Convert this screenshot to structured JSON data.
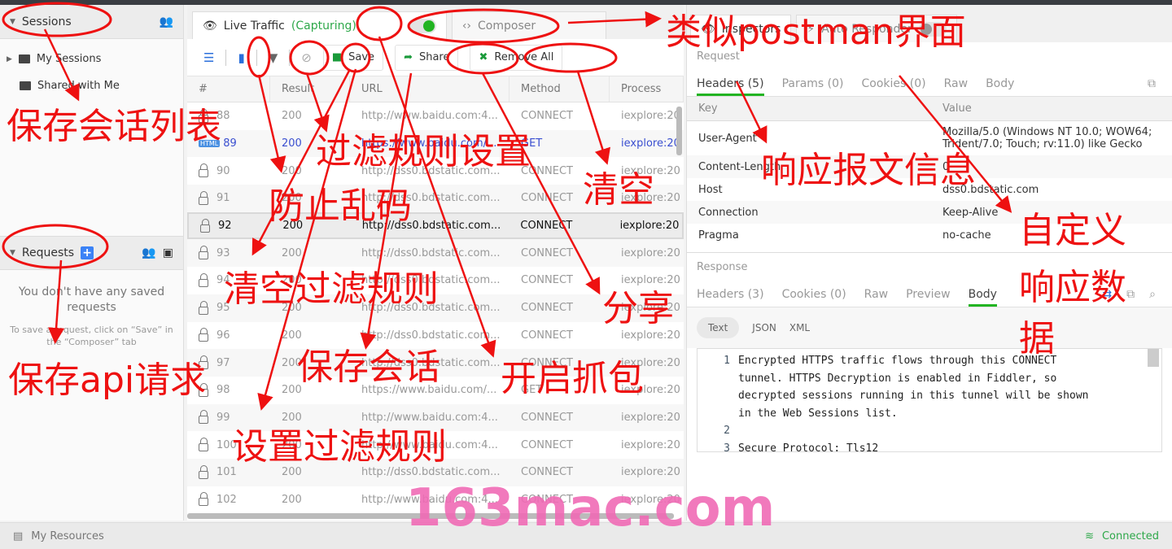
{
  "sidebar": {
    "sessions_title": "Sessions",
    "items": [
      {
        "label": "My Sessions"
      },
      {
        "label": "Shared with Me"
      }
    ],
    "requests_title": "Requests",
    "empty_title": "You don't have any saved requests",
    "empty_hint": "To save a request, click on “Save” in the “Composer” tab"
  },
  "main": {
    "tabs": [
      {
        "label": "Live Traffic",
        "status": "(Capturing)",
        "capturing": true
      },
      {
        "label": "Composer"
      }
    ],
    "toolbar": {
      "save": "Save",
      "share": "Share",
      "remove_all": "Remove All"
    },
    "columns": [
      "#",
      "Result",
      "URL",
      "Method",
      "Process"
    ],
    "rows": [
      {
        "id": "88",
        "result": "200",
        "url": "http://www.baidu.com:4...",
        "method": "CONNECT",
        "process": "iexplore:20"
      },
      {
        "id": "89",
        "result": "200",
        "url": "https://www.baidu.com/...",
        "method": "GET",
        "process": "iexplore:20",
        "badge": "HTML"
      },
      {
        "id": "90",
        "result": "200",
        "url": "http://dss0.bdstatic.com...",
        "method": "CONNECT",
        "process": "iexplore:20"
      },
      {
        "id": "91",
        "result": "200",
        "url": "http://dss0.bdstatic.com...",
        "method": "CONNECT",
        "process": "iexplore:20"
      },
      {
        "id": "92",
        "result": "200",
        "url": "http://dss0.bdstatic.com...",
        "method": "CONNECT",
        "process": "iexplore:20",
        "selected": true
      },
      {
        "id": "93",
        "result": "200",
        "url": "http://dss0.bdstatic.com...",
        "method": "CONNECT",
        "process": "iexplore:20"
      },
      {
        "id": "94",
        "result": "200",
        "url": "http://dss0.bdstatic.com...",
        "method": "CONNECT",
        "process": "iexplore:20"
      },
      {
        "id": "95",
        "result": "200",
        "url": "http://dss0.bdstatic.com...",
        "method": "CONNECT",
        "process": "iexplore:20"
      },
      {
        "id": "96",
        "result": "200",
        "url": "http://dss0.bdstatic.com...",
        "method": "CONNECT",
        "process": "iexplore:20"
      },
      {
        "id": "97",
        "result": "200",
        "url": "http://dss0.bdstatic.com...",
        "method": "CONNECT",
        "process": "iexplore:20"
      },
      {
        "id": "98",
        "result": "200",
        "url": "https://www.baidu.com/...",
        "method": "GET",
        "process": "iexplore:20"
      },
      {
        "id": "99",
        "result": "200",
        "url": "http://www.baidu.com:4...",
        "method": "CONNECT",
        "process": "iexplore:20"
      },
      {
        "id": "100",
        "result": "200",
        "url": "http://www.baidu.com:4...",
        "method": "CONNECT",
        "process": "iexplore:20"
      },
      {
        "id": "101",
        "result": "200",
        "url": "http://dss0.bdstatic.com...",
        "method": "CONNECT",
        "process": "iexplore:20"
      },
      {
        "id": "102",
        "result": "200",
        "url": "http://www.baidu.com:4...",
        "method": "CONNECT",
        "process": "iexplore:20"
      }
    ]
  },
  "inspector": {
    "tabs": [
      {
        "label": "Inspectors"
      },
      {
        "label": "Auto Responder",
        "enabled": false
      }
    ],
    "request_label": "Request",
    "request_tabs": [
      "Headers (5)",
      "Params (0)",
      "Cookies (0)",
      "Raw",
      "Body"
    ],
    "headers_cols": [
      "Key",
      "Value"
    ],
    "headers": [
      {
        "key": "User-Agent",
        "value": "Mozilla/5.0 (Windows NT 10.0; WOW64; Trident/7.0; Touch; rv:11.0) like Gecko"
      },
      {
        "key": "Content-Length",
        "value": "0"
      },
      {
        "key": "Host",
        "value": "dss0.bdstatic.com"
      },
      {
        "key": "Connection",
        "value": "Keep-Alive"
      },
      {
        "key": "Pragma",
        "value": "no-cache"
      }
    ],
    "response_label": "Response",
    "response_tabs": [
      "Headers (3)",
      "Cookies (0)",
      "Raw",
      "Preview",
      "Body"
    ],
    "formats": [
      "Text",
      "JSON",
      "XML"
    ],
    "body_lines": [
      {
        "n": "1",
        "text": "Encrypted HTTPS traffic flows through this CONNECT"
      },
      {
        "n": "",
        "text": "tunnel. HTTPS Decryption is enabled in Fiddler, so"
      },
      {
        "n": "",
        "text": "decrypted sessions running in this tunnel will be shown"
      },
      {
        "n": "",
        "text": "in the Web Sessions list."
      },
      {
        "n": "2",
        "text": ""
      },
      {
        "n": "3",
        "text": "Secure Protocol: Tls12"
      }
    ]
  },
  "status": {
    "resources": "My Resources",
    "connection": "Connected"
  },
  "annotations": {
    "postman": "类似postman界面",
    "session_list": "保存会话列表",
    "filter_settings": "过滤规则设置",
    "decode": "防止乱码",
    "clear": "清空",
    "response_info": "响应报文信息",
    "custom1": "自定义",
    "custom2": "响应数",
    "custom3": "据",
    "clear_filter": "清空过滤规则",
    "share": "分享",
    "save_session": "保存会话",
    "capture": "开启抓包",
    "save_api": "保存api请求",
    "set_filter": "设置过滤规则"
  },
  "watermark": "163mac.com",
  "colors": {
    "accent_green": "#22b422",
    "annotation_red": "#ee1111",
    "watermark_pink": "#f06bb5"
  }
}
